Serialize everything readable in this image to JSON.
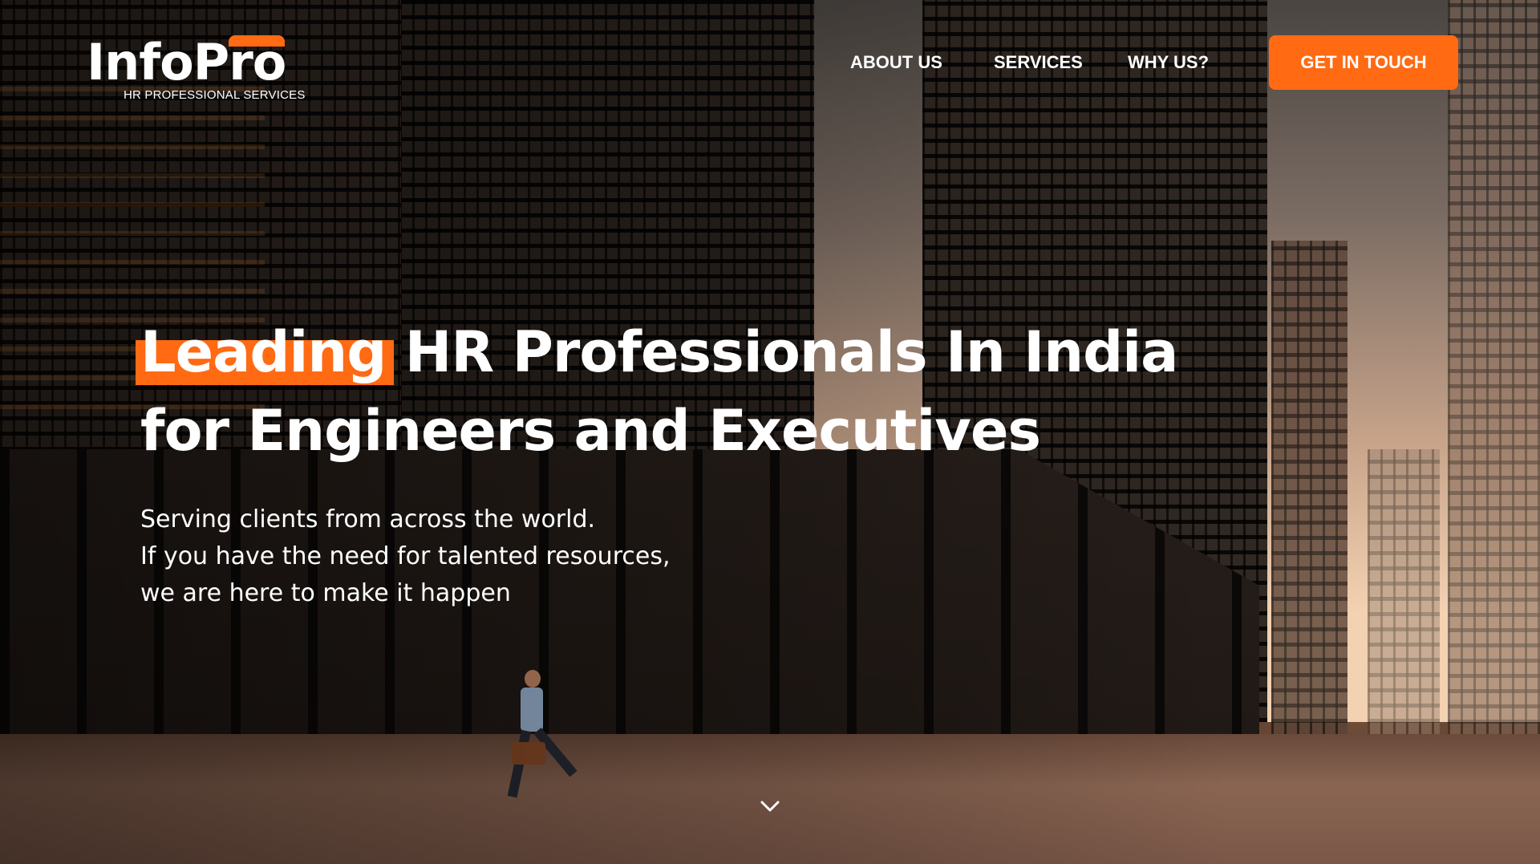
{
  "brand": {
    "name": "InfoPro",
    "tagline": "HR PROFESSIONAL SERVICES",
    "accent_color": "#ff6a13"
  },
  "nav": {
    "items": [
      {
        "label": "ABOUT US"
      },
      {
        "label": "SERVICES"
      },
      {
        "label": "WHY US?"
      }
    ],
    "cta_label": "GET IN TOUCH"
  },
  "hero": {
    "headline_highlight": "Leading",
    "headline_line1_rest": "HR Professionals In India",
    "headline_line2": "for Engineers and Executives",
    "sub_lines": [
      "Serving clients from across the world.",
      "If you have the need for talented resources,",
      "we are here to make it happen"
    ],
    "scroll_icon": "chevron-down-icon"
  }
}
